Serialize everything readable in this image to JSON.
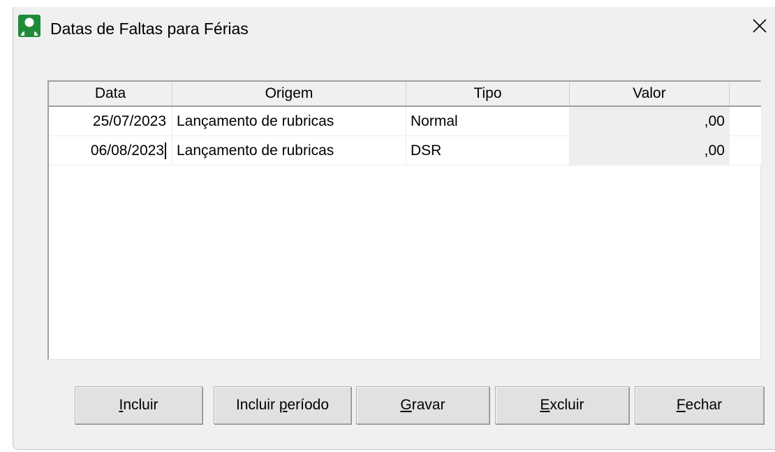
{
  "window": {
    "title": "Datas de Faltas para Férias",
    "icon": "user-icon",
    "accent_color": "#1f8a3a"
  },
  "grid": {
    "columns": [
      "Data",
      "Origem",
      "Tipo",
      "Valor"
    ],
    "rows": [
      {
        "data": "25/07/2023",
        "origem": "Lançamento de rubricas",
        "tipo": "Normal",
        "valor": ",00"
      },
      {
        "data": "06/08/2023",
        "origem": "Lançamento de rubricas",
        "tipo": "DSR",
        "valor": ",00"
      }
    ]
  },
  "buttons": {
    "incluir": {
      "mnemonic": "I",
      "rest": "ncluir"
    },
    "incluir_periodo": {
      "before": "Incluir ",
      "mnemonic": "p",
      "rest": "eríodo"
    },
    "gravar": {
      "mnemonic": "G",
      "rest": "ravar"
    },
    "excluir": {
      "mnemonic": "E",
      "rest": "xcluir"
    },
    "fechar": {
      "mnemonic": "F",
      "rest": "echar"
    }
  }
}
